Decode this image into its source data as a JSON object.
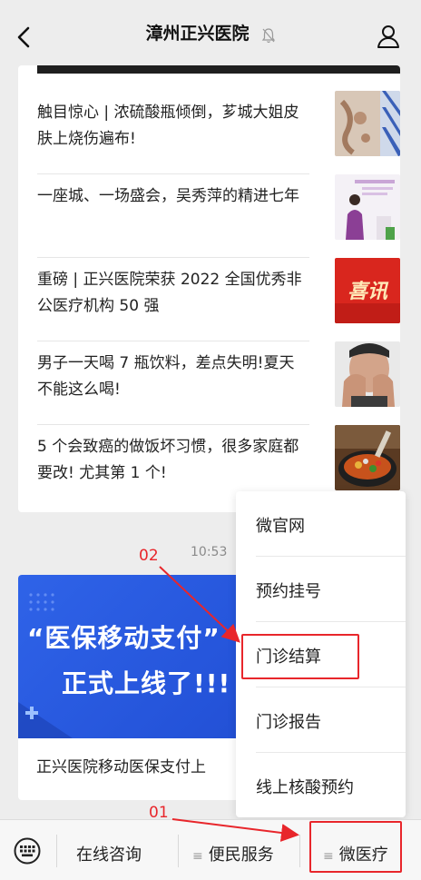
{
  "header": {
    "title": "漳州正兴医院"
  },
  "articles": [
    {
      "title": "触目惊心 | 浓硫酸瓶倾倒，芗城大姐皮肤上烧伤遍布!"
    },
    {
      "title": "一座城、一场盛会，吴秀萍的精进七年"
    },
    {
      "title": "重磅 | 正兴医院荣获 2022 全国优秀非公医疗机构 50 强",
      "thumb_text": "喜讯"
    },
    {
      "title": "男子一天喝 7 瓶饮料，差点失明!夏天不能这么喝!"
    },
    {
      "title": "5 个会致癌的做饭坏习惯，很多家庭都要改! 尤其第 1 个!"
    }
  ],
  "message": {
    "time": "10:53",
    "banner_line1": "“医保移动支付”",
    "banner_line2": "正式上线了!!!",
    "caption": "正兴医院移动医保支付上"
  },
  "popup_menu": {
    "items": [
      {
        "label": "微官网"
      },
      {
        "label": "预约挂号"
      },
      {
        "label": "门诊结算"
      },
      {
        "label": "门诊报告"
      },
      {
        "label": "线上核酸预约"
      }
    ]
  },
  "bottom_menu": {
    "items": [
      {
        "label": "在线咨询"
      },
      {
        "label": "便民服务"
      },
      {
        "label": "微医疗"
      }
    ],
    "menu_glyph": "≡"
  },
  "annotations": {
    "step1": "01",
    "step2": "02"
  },
  "colors": {
    "highlight": "#e8262b",
    "banner_blue": "#2f63e8"
  }
}
